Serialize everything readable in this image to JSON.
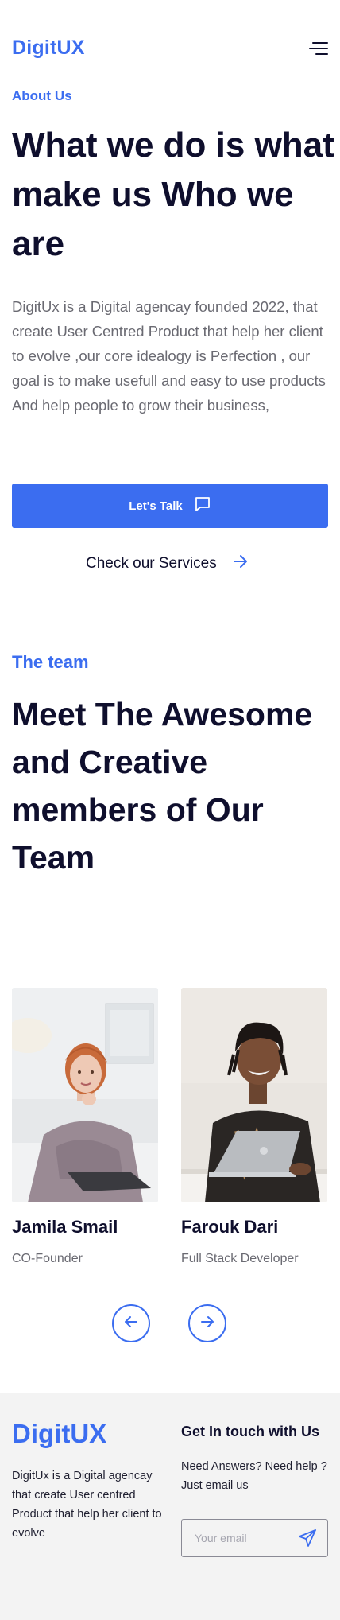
{
  "header": {
    "logo": "DigitUX",
    "menu_icon": "hamburger-menu-icon"
  },
  "about": {
    "eyebrow": "About Us",
    "title": "What we do is what make us Who we are",
    "description": "DigitUx is a Digital agencay founded 2022, that create User Centred Product that help her client to evolve ,our core idealogy is Perfection , our goal is to make usefull and easy to use products And help people to grow their business,",
    "cta_label": "Let's Talk",
    "cta_icon": "chat-bubble-icon",
    "services_label": "Check our Services",
    "services_icon": "arrow-right-icon"
  },
  "team": {
    "eyebrow": "The team",
    "title": "Meet The Awesome and Creative members of Our Team",
    "members": [
      {
        "name": "Jamila Smail",
        "role": "CO-Founder"
      },
      {
        "name": "Farouk Dari",
        "role": "Full Stack Developer"
      }
    ],
    "prev_icon": "arrow-left-icon",
    "next_icon": "arrow-right-icon"
  },
  "footer": {
    "logo": "DigitUX",
    "description": "DigitUx is a Digital agencay that create User centred Product that help her client to evolve",
    "contact_heading": "Get In touch with Us",
    "contact_description": "Need Answers? Need help ? Just email us",
    "email_placeholder": "Your email",
    "send_icon": "paper-plane-icon"
  },
  "colors": {
    "accent": "#3b6df0",
    "heading": "#0f0f2d",
    "body_text": "#6a6a72",
    "footer_bg": "#f3f3f3"
  }
}
